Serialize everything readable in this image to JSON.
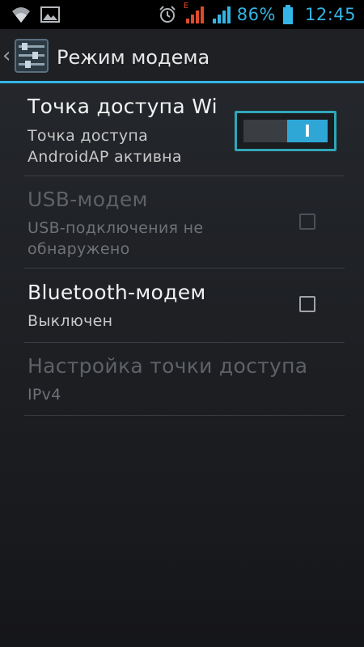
{
  "status_bar": {
    "battery_percent": "86%",
    "time": "12:45",
    "network_type": "E",
    "icons": [
      "wifi-icon",
      "image-icon",
      "alarm-icon",
      "signal-icon",
      "signal-icon-2",
      "battery-icon"
    ]
  },
  "action_bar": {
    "title": "Режим модема",
    "icon": "settings-icon"
  },
  "preferences": [
    {
      "title": "Точка доступа Wi",
      "summary": "Точка доступа AndroidAP активна",
      "enabled": true,
      "widget": "switch",
      "switch_state": "I",
      "checked": true
    },
    {
      "title": "USB-модем",
      "summary": "USB-подключения не обнаружено",
      "enabled": false,
      "widget": "checkbox",
      "checked": false
    },
    {
      "title": "Bluetooth-модем",
      "summary": "Выключен",
      "enabled": true,
      "widget": "checkbox",
      "checked": false
    },
    {
      "title": "Настройка точки доступа",
      "summary": "IPv4",
      "enabled": false,
      "widget": "none"
    }
  ],
  "colors": {
    "accent": "#33b5e5",
    "switch_on": "#2fa7d6",
    "background": "#1d1f23"
  }
}
